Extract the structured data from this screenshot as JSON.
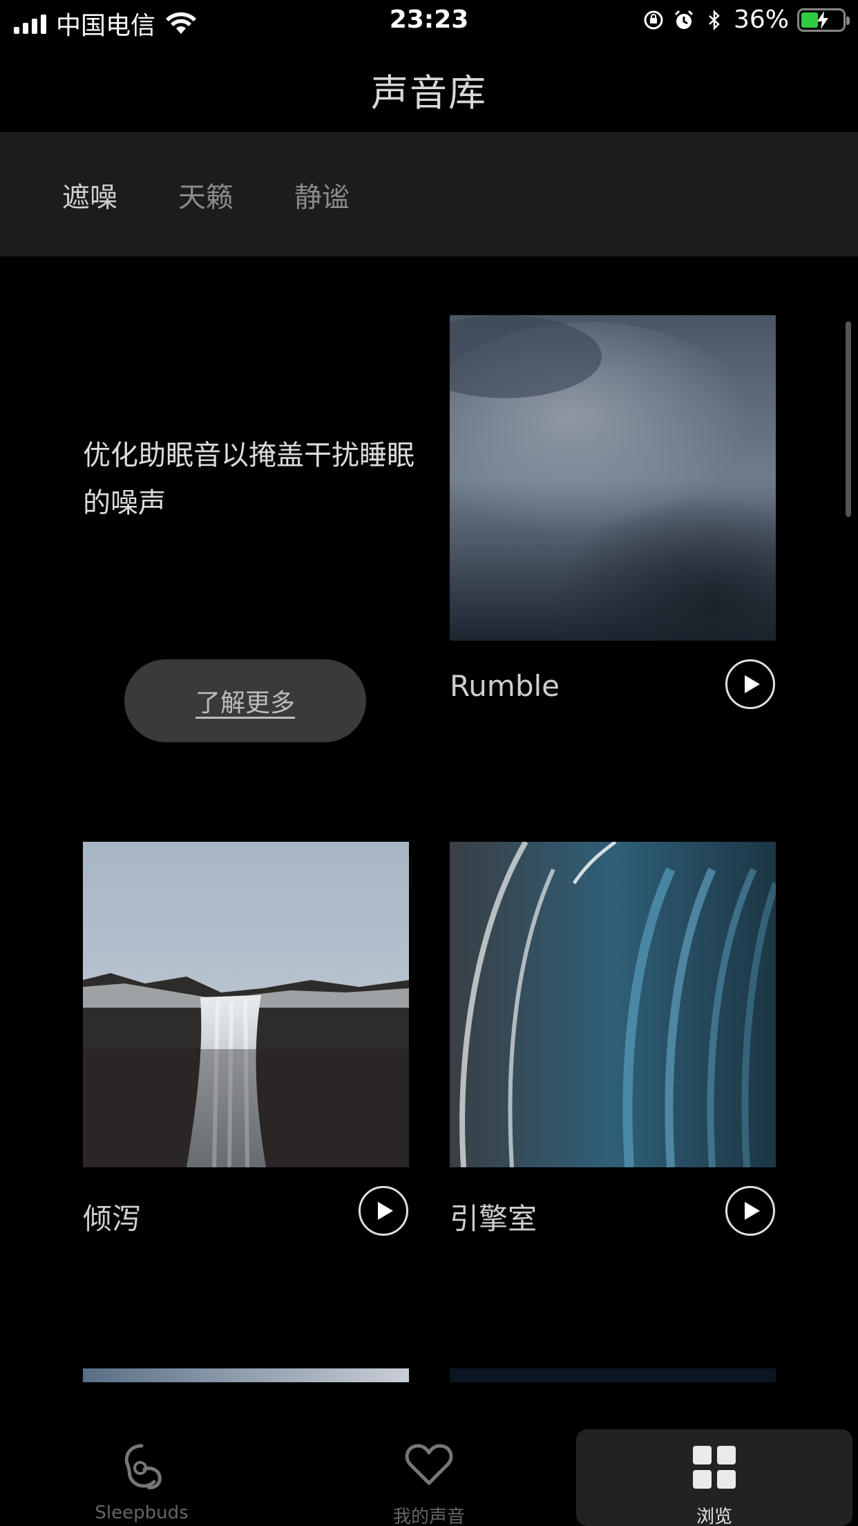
{
  "status_bar": {
    "carrier": "中国电信",
    "time": "23:23",
    "battery_percent": "36%"
  },
  "header": {
    "title": "声音库"
  },
  "tabs": [
    {
      "label": "遮噪",
      "active": true
    },
    {
      "label": "天籁",
      "active": false
    },
    {
      "label": "静谧",
      "active": false
    }
  ],
  "intro": {
    "description": "优化助眠音以掩盖干扰睡眠的噪声",
    "learn_more_label": "了解更多"
  },
  "sounds": [
    {
      "name": "Rumble",
      "image": "storm-clouds"
    },
    {
      "name": "倾泻",
      "image": "waterfall"
    },
    {
      "name": "引擎室",
      "image": "blurred-blue-lights"
    }
  ],
  "bottom_tabs": [
    {
      "label": "Sleepbuds",
      "icon": "sleepbuds-icon",
      "active": false
    },
    {
      "label": "我的声音",
      "icon": "heart-icon",
      "active": false
    },
    {
      "label": "浏览",
      "icon": "grid-icon",
      "active": true
    }
  ],
  "colors": {
    "background": "#000000",
    "tab_bar_bg": "#1c1c1c",
    "battery_green": "#2ecc40"
  }
}
